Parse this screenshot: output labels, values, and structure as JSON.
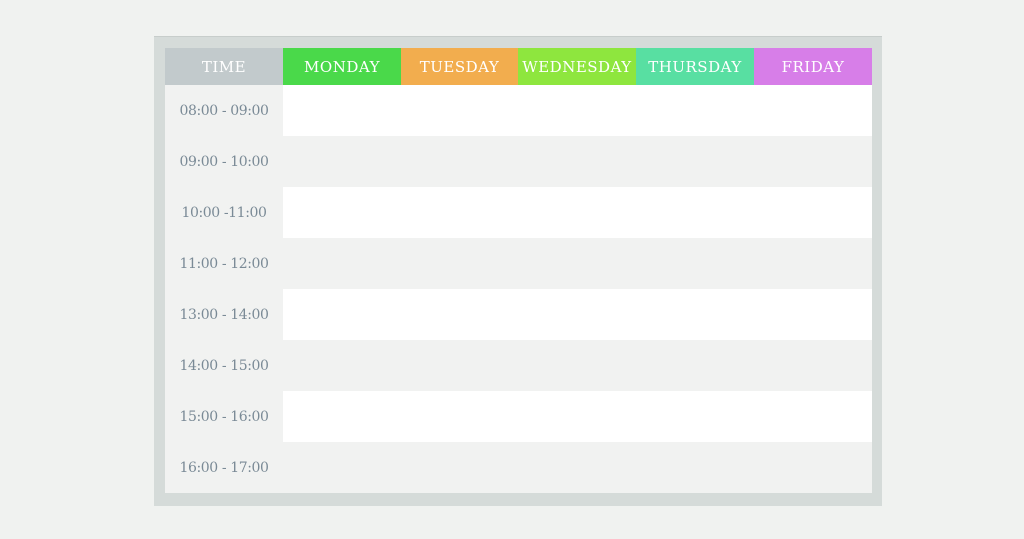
{
  "header": {
    "time_label": "TIME",
    "days": [
      "MONDAY",
      "TUESDAY",
      "WEDNESDAY",
      "THURSDAY",
      "FRIDAY"
    ]
  },
  "colors": {
    "time_header": "#c2cacc",
    "monday": "#4ad94a",
    "tuesday": "#f2ad4e",
    "wednesday": "#8ee63e",
    "thursday": "#58dfa2",
    "friday": "#d77ee8"
  },
  "time_slots": [
    "08:00 - 09:00",
    "09:00 - 10:00",
    "10:00 -11:00",
    "11:00 - 12:00",
    "13:00 - 14:00",
    "14:00 - 15:00",
    "15:00 - 16:00",
    "16:00 - 17:00"
  ]
}
